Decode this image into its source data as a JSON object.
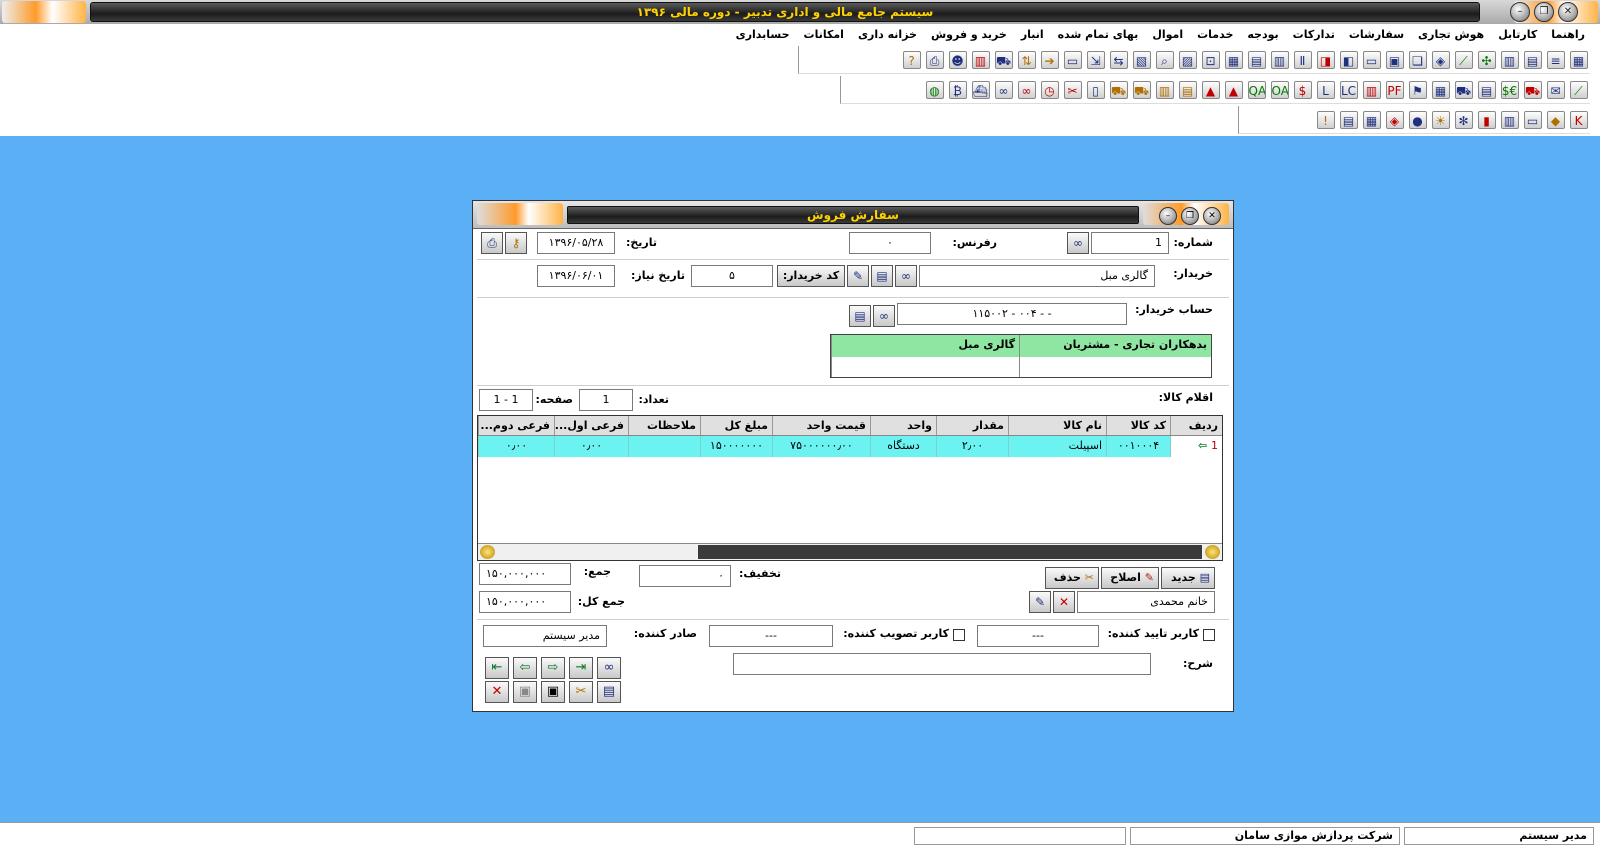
{
  "app": {
    "title": "سیستم جامع مالی و اداری تدبیر - دوره مالی ۱۳۹۶"
  },
  "menu": [
    "حسابداری",
    "امکانات",
    "خزانه داری",
    "خرید و فروش",
    "انبار",
    "بهای تمام شده",
    "اموال",
    "خدمات",
    "بودجه",
    "تدارکات",
    "سفارشات",
    "هوش تجاری",
    "کارتابل",
    "راهنما"
  ],
  "toolbar_text": {
    "oa": "OA",
    "qa": "QA",
    "lc": "LC",
    "dollar_euro": "$€",
    "dollar": "$",
    "pf": "PF"
  },
  "dialog": {
    "title": "سفارش فروش",
    "number_label": "شماره:",
    "number_value": "1",
    "reference_label": "رفرنس:",
    "reference_value": "۰",
    "date_label": "تاریخ:",
    "date_value": "۱۳۹۶/۰۵/۲۸",
    "buyer_label": "خریدار:",
    "buyer_value": "گالری مبل",
    "buyer_code_button": "کد خریدار:",
    "buyer_code_value": "۵",
    "need_date_label": "تاریخ نیاز:",
    "need_date_value": "۱۳۹۶/۰۶/۰۱",
    "buyer_account_label": "حساب خریدار:",
    "buyer_account_value": "- - ۰۰۴ - ۱۱۵۰۰۲",
    "account_table": {
      "col1": "بدهکاران تجاری - مشتریان",
      "col2": "گالری مبل"
    },
    "items_label": "اقلام کالا:",
    "count_label": "تعداد:",
    "count_value": "1",
    "page_label": "صفحه:",
    "page_value": "1 - 1",
    "grid": {
      "columns": [
        "ردیف",
        "کد کالا",
        "نام کالا",
        "مقدار",
        "واحد",
        "قیمت واحد",
        "مبلغ کل",
        "ملاحظات",
        "فرعی اول...",
        "فرعی دوم..."
      ],
      "rows": [
        [
          "1",
          "۰۰۱۰۰۰۴",
          "اسپیلت",
          "۲٫۰۰",
          "دستگاه",
          "۷۵۰۰۰۰۰۰٫۰۰",
          "۱۵۰۰۰۰۰۰۰",
          "",
          "۰٫۰۰",
          "۰٫۰۰"
        ]
      ]
    },
    "new_button": "جدید",
    "edit_button": "اصلاح",
    "delete_button": "حذف",
    "person_value": "خانم محمدی",
    "discount_label": "تخفیف:",
    "discount_value": "۰",
    "sum_label": "جمع:",
    "sum_value": "۱۵۰,۰۰۰,۰۰۰",
    "total_label": "جمع کل:",
    "total_value": "۱۵۰,۰۰۰,۰۰۰",
    "confirm_user_label": "کاربر تایید کننده:",
    "confirm_user_value": "---",
    "approve_user_label": "کاربر تصویب کننده:",
    "approve_user_value": "---",
    "issuer_label": "صادر کننده:",
    "issuer_value": "مدیر سیستم",
    "description_label": "شرح:",
    "description_value": ""
  },
  "status": {
    "user": "مدیر سیستم",
    "company": "شرکت پردازش موازی سامان"
  },
  "colors": {
    "desktop": "#5aaff5",
    "title_text": "#ffd200",
    "selected_row": "#6df2f2",
    "account_header": "#8fe6a2"
  }
}
